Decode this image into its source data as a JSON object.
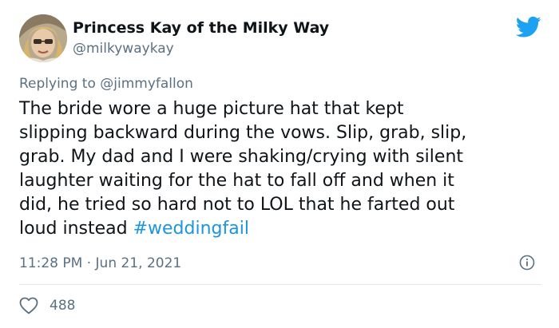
{
  "user": {
    "name": "Princess Kay of the Milky Way",
    "handle": "@milkywaykay",
    "avatar": "profile-photo"
  },
  "reply": {
    "prefix": "Replying to ",
    "mention": "@jimmyfallon"
  },
  "tweet": {
    "lines": [
      "The bride wore a huge picture hat that kept",
      "slipping backward during the vows. Slip, grab, slip,",
      "grab. My dad and I were shaking/crying with silent",
      "laughter waiting for the hat to fall off and when it",
      "did, he tried so hard not to LOL that he farted out"
    ],
    "last_line_text": "loud instead ",
    "hashtag": "#weddingfail"
  },
  "meta": {
    "time": "11:28 PM",
    "separator": " · ",
    "date": "Jun 21, 2021"
  },
  "likes": {
    "count": "488"
  },
  "icons": {
    "brand": "twitter-bird-icon",
    "info": "info-icon",
    "like": "heart-icon"
  },
  "colors": {
    "brand_blue": "#1da1f2",
    "hashtag": "#1b95e0",
    "secondary_text": "#5b7083",
    "primary_text": "#0f1419",
    "divider": "#e1e8ed"
  }
}
